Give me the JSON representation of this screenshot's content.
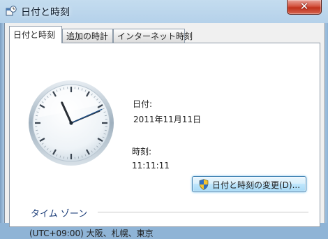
{
  "window": {
    "title": "日付と時刻",
    "close_label": "✕"
  },
  "tabs": [
    {
      "label": "日付と時刻",
      "active": true
    },
    {
      "label": "追加の時計",
      "active": false
    },
    {
      "label": "インターネット時刻",
      "active": false
    }
  ],
  "date": {
    "label": "日付:",
    "value": "2011年11月11日"
  },
  "time": {
    "label": "時刻:",
    "value": "11:11:11"
  },
  "change_button": {
    "label": "日付と時刻の変更(D)...",
    "icon": "uac-shield-icon"
  },
  "timezone": {
    "heading": "タイム ゾーン",
    "value": "(UTC+09:00) 大阪、札幌、東京"
  },
  "clock": {
    "hour": 11,
    "minute": 11,
    "second": 11
  },
  "colors": {
    "heading_blue": "#1e3f7a",
    "close_red": "#c1311c"
  }
}
